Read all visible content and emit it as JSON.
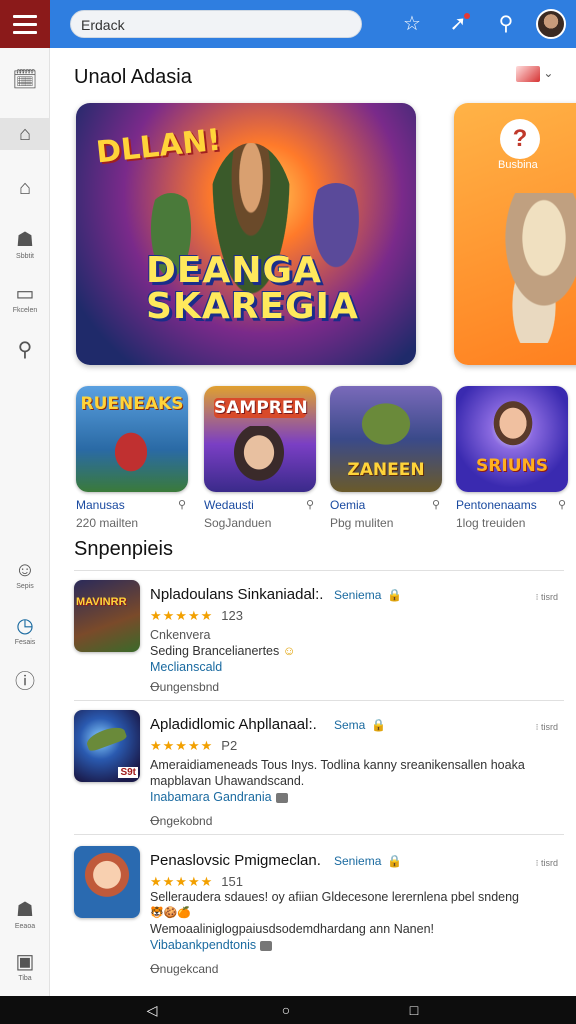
{
  "search": {
    "value": "Erdack"
  },
  "sidebar": {
    "items": [
      {
        "icon": "calendar-icon",
        "glyph": "🗓",
        "label": ""
      },
      {
        "icon": "store-icon",
        "glyph": "⌂",
        "label": ""
      },
      {
        "icon": "home-icon",
        "glyph": "⌂",
        "label": ""
      },
      {
        "icon": "user-icon",
        "glyph": "☗",
        "label": "Sbbtit"
      },
      {
        "icon": "monitor-icon",
        "glyph": "▭",
        "label": "Fkcelen"
      },
      {
        "icon": "search-icon",
        "glyph": "⚲",
        "label": ""
      },
      {
        "icon": "face-icon",
        "glyph": "☺",
        "label": "Sepis"
      },
      {
        "icon": "clock-icon",
        "glyph": "◷",
        "label": "Fesais"
      },
      {
        "icon": "info-icon",
        "glyph": "ⓘ",
        "label": ""
      },
      {
        "icon": "person-icon",
        "glyph": "☗",
        "label": "Eeaoa"
      },
      {
        "icon": "archive-icon",
        "glyph": "▣",
        "label": "Tiba"
      }
    ]
  },
  "featured": {
    "title": "Unaol Adasia",
    "banner1": {
      "line1": "DLLAN!",
      "line2": "DEANGA",
      "line3": "SKAREGIA"
    },
    "banner2": {
      "badge": "?",
      "text": "Busbina"
    }
  },
  "apps": [
    {
      "name": "Manusas",
      "sub": "220 mailten",
      "icon_text": "RUENEAKS",
      "bg": "#2a7ab5"
    },
    {
      "name": "Wedausti",
      "sub": "SogJanduen",
      "icon_text": "SAMPREN",
      "bg": "#7a3fc4"
    },
    {
      "name": "Oemia",
      "sub": "Pbg muliten",
      "icon_text": "ZANEEN",
      "bg": "#3a4a8a"
    },
    {
      "name": "Pentonenaams",
      "sub": "1log treuiden",
      "icon_text": "SRIUNS",
      "bg": "#4a2ab0"
    }
  ],
  "section2": {
    "title": "Snpenpieis"
  },
  "list": [
    {
      "title": "Npladoulans Sinkaniadal:.",
      "tag": "Seniema",
      "right": "tisrd",
      "stars": "★★★★★",
      "rating_count": "123",
      "desc1": "Cnkenvera",
      "desc2": "Seding Brancelianertes",
      "link": "Meclianscald",
      "meta": "Ꝋungensbnd"
    },
    {
      "title": "Apladidlomic Ahpllanaal:.",
      "tag": "Sema",
      "right": "tisrd",
      "stars": "★★★★★",
      "rating_count": "P2",
      "desc1": "Ameraidiameneads Tous Inys. Todlina kanny sreanikensallen hoaka",
      "desc2": "mapblavan Uhawandscand.",
      "link": "Inabamara Gandrania",
      "meta": "Ꝋngekobnd"
    },
    {
      "title": "Penaslovsic Pmigmeclan.",
      "tag": "Seniema",
      "right": "tisrd",
      "stars": "★★★★★",
      "rating_count": "151",
      "desc1": "Selleraudera sdaues! oy afiian Gldecesone lerernlena pbel sndeng",
      "desc2": "Wemoaaliniglogpaiusdsodemdhardang ann Nanen!",
      "link": "Vibabankpendtonis",
      "meta": "Ꝋnugekcand"
    }
  ],
  "colors": {
    "topbar": "#2f7ee0",
    "menu": "#8b1a1a",
    "star": "#f2a000",
    "link": "#1a6aa0"
  }
}
